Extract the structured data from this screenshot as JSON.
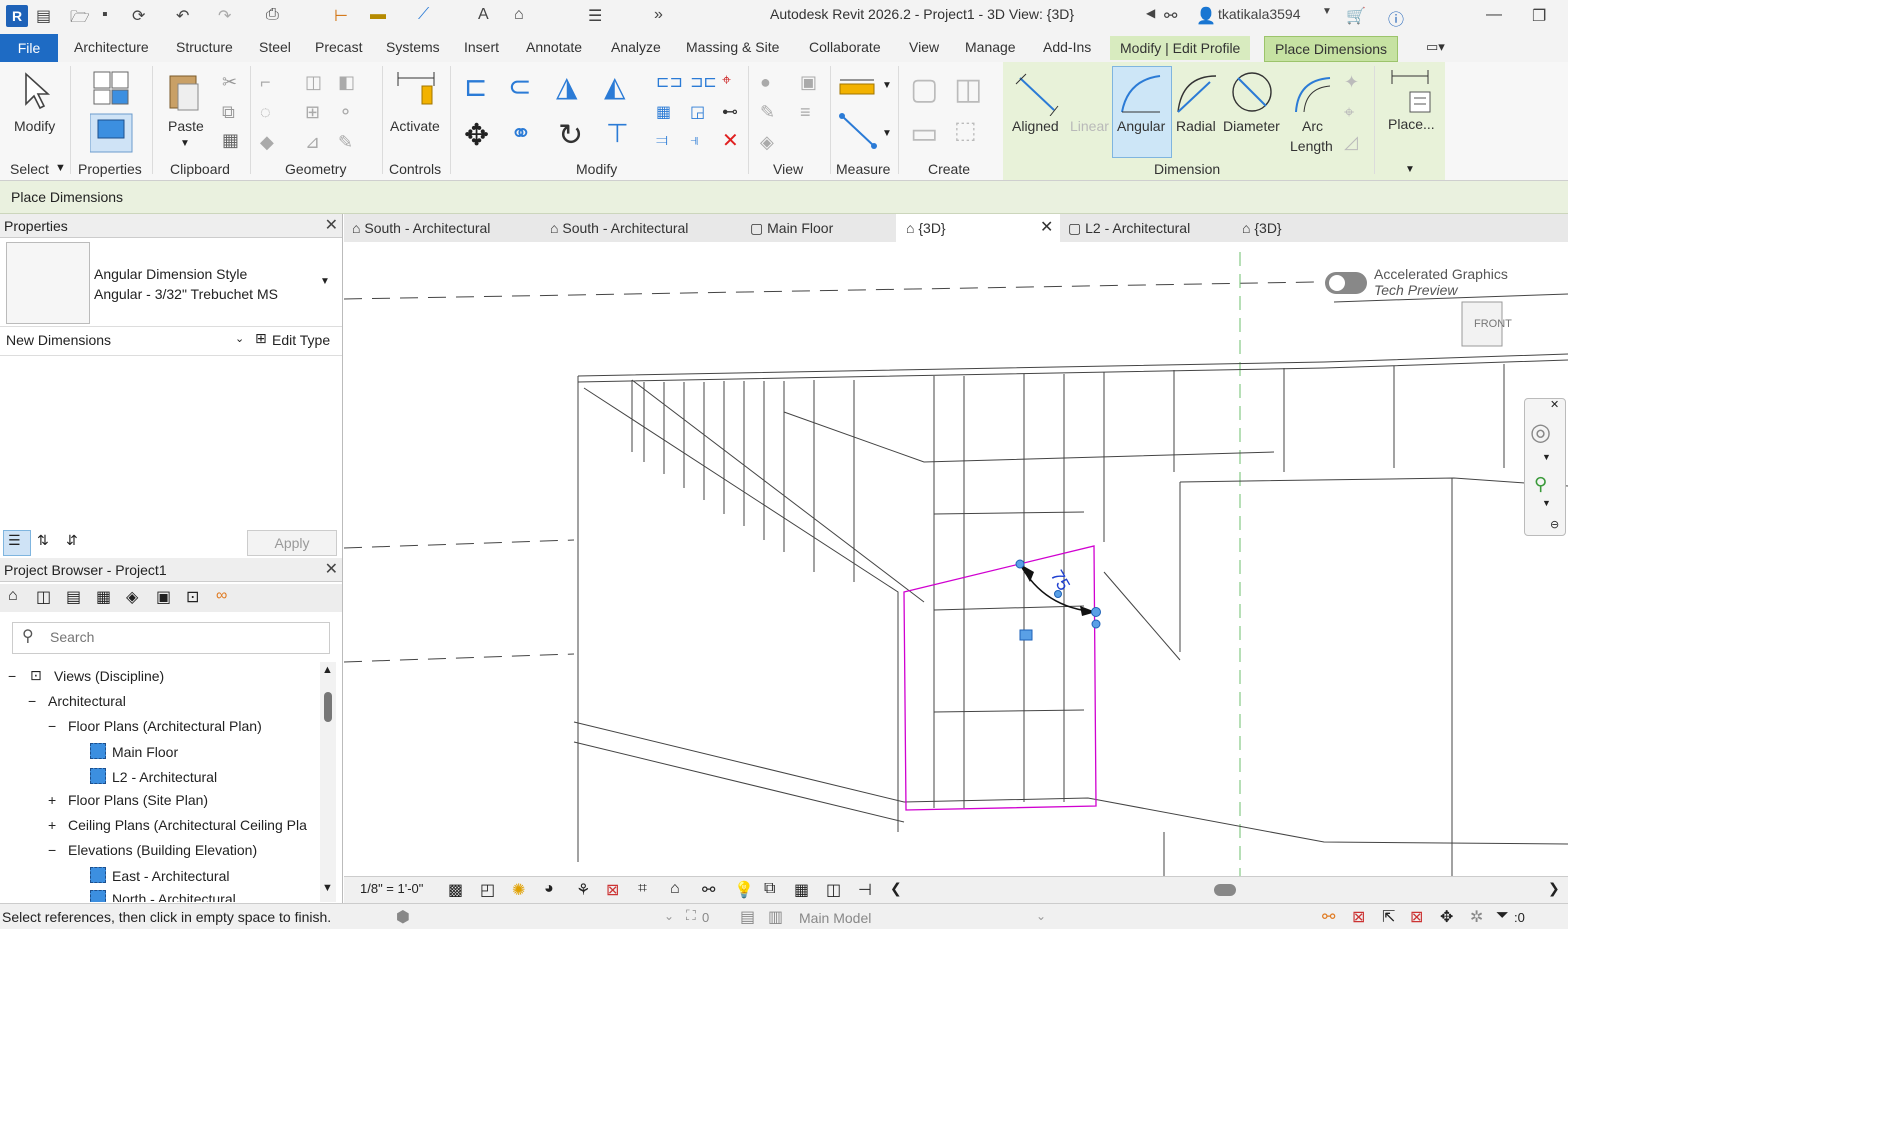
{
  "app": {
    "title": "Autodesk Revit 2026.2 - Project1 - 3D View: {3D}",
    "user": "tkatikala3594"
  },
  "menu": {
    "file": "File",
    "tabs": [
      "Architecture",
      "Structure",
      "Steel",
      "Precast",
      "Systems",
      "Insert",
      "Annotate",
      "Analyze",
      "Massing & Site",
      "Collaborate",
      "View",
      "Manage",
      "Add-Ins"
    ],
    "context_tabs": [
      "Modify | Edit Profile",
      "Place Dimensions"
    ]
  },
  "ribbon": {
    "modify": "Modify",
    "properties": "Properties",
    "paste": "Paste",
    "activate": "Activate",
    "groups": [
      "Select",
      "Properties",
      "Clipboard",
      "Geometry",
      "Controls",
      "Modify",
      "View",
      "Measure",
      "Create",
      "Dimension"
    ],
    "dimension_buttons": [
      "Aligned",
      "Linear",
      "Angular",
      "Radial",
      "Diameter",
      "Arc",
      "Length"
    ],
    "place": "Place..."
  },
  "options_bar": {
    "label": "Place Dimensions"
  },
  "properties": {
    "title": "Properties",
    "type_line1": "Angular Dimension Style",
    "type_line2": "Angular - 3/32\" Trebuchet MS",
    "selector": "New Dimensions",
    "edit_type": "Edit Type",
    "apply": "Apply"
  },
  "browser": {
    "title": "Project Browser - Project1",
    "search_placeholder": "Search",
    "tree": [
      "Views (Discipline)",
      "Architectural",
      "Floor Plans (Architectural Plan)",
      "Main Floor",
      "L2 - Architectural",
      "Floor Plans (Site Plan)",
      "Ceiling Plans (Architectural Ceiling Pla",
      "Elevations (Building Elevation)",
      "East - Architectural",
      "North - Architectural"
    ]
  },
  "view_tabs": [
    "South - Architectural",
    "South - Architectural",
    "Main Floor",
    "{3D}",
    "L2 - Architectural",
    "{3D}"
  ],
  "viewport": {
    "accelerated": "Accelerated Graphics",
    "tech_preview": "Tech Preview",
    "viewcube": "FRONT",
    "dim_value": "75"
  },
  "view_control": {
    "scale": "1/8\" = 1'-0\""
  },
  "status": {
    "message": "Select references, then click in empty space to finish.",
    "model": "Main Model",
    "count": "0",
    "filter": ":0"
  }
}
